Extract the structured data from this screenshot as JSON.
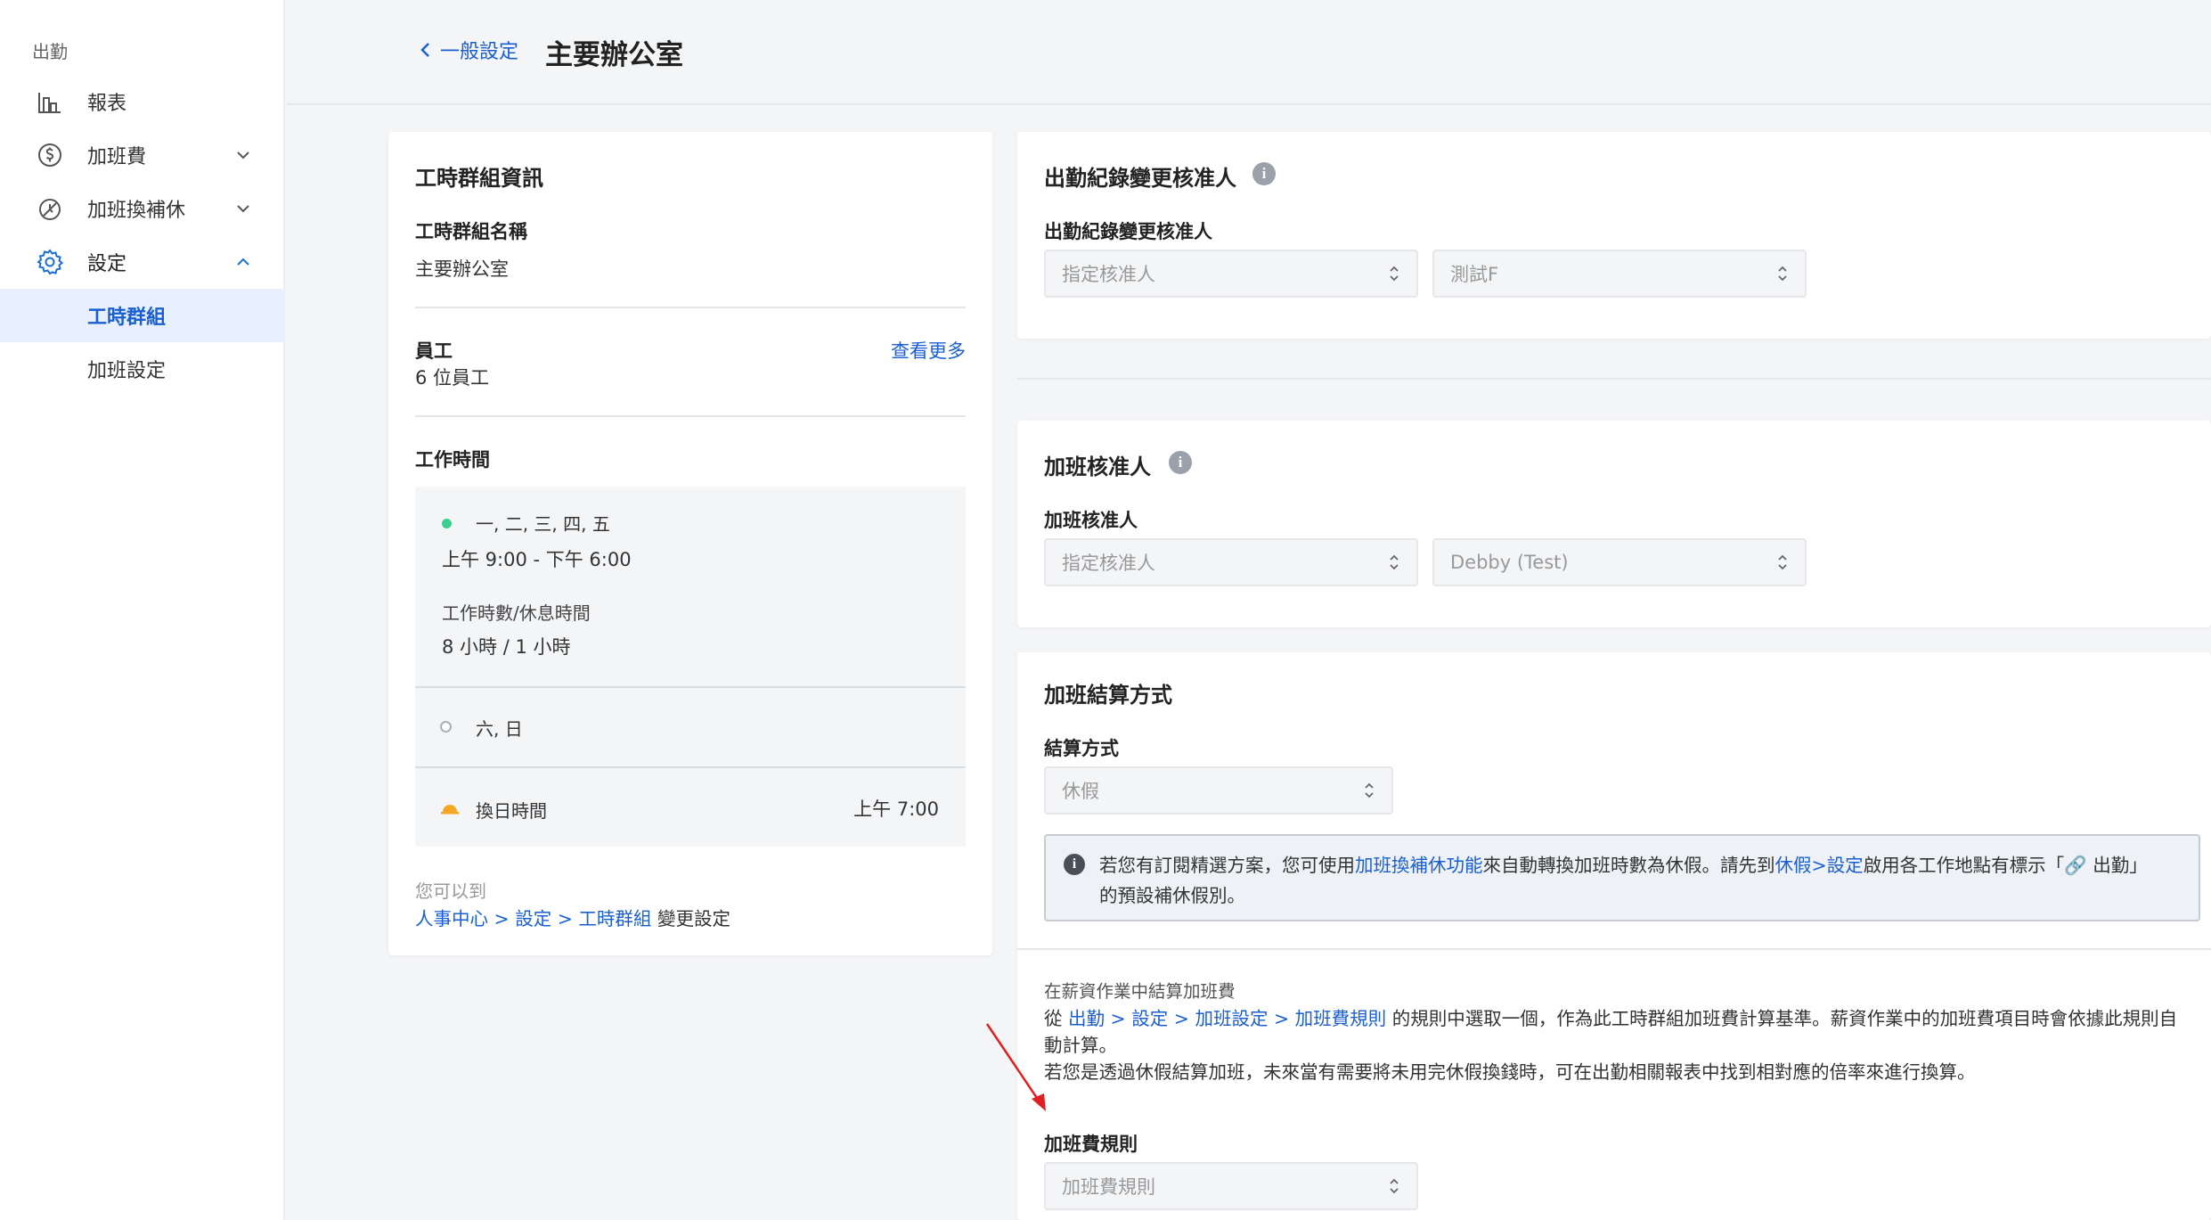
{
  "sidebar": {
    "section_title": "出勤",
    "items": [
      {
        "label": "報表",
        "icon": "report-chart-icon"
      },
      {
        "label": "加班費",
        "icon": "dollar-circle-icon"
      },
      {
        "label": "加班換補休",
        "icon": "swap-time-icon"
      },
      {
        "label": "設定",
        "icon": "gear-icon"
      },
      {
        "label": "工時群組"
      },
      {
        "label": "加班設定"
      }
    ]
  },
  "header": {
    "back_label": "一般設定",
    "title": "主要辦公室"
  },
  "left_card": {
    "title": "工時群組資訊",
    "group_name_label": "工時群組名稱",
    "group_name_value": "主要辦公室",
    "employees_label": "員工",
    "employees_value": "6 位員工",
    "view_more": "查看更多",
    "work_time_label": "工作時間",
    "workdays": "一, 二, 三, 四, 五",
    "workhours": "上午 9:00 - 下午 6:00",
    "hours_break_label": "工作時數/休息時間",
    "hours_break_value": "8 小時 / 1 小時",
    "weekend": "六, 日",
    "day_change_label": "換日時間",
    "day_change_value": "上午 7:00",
    "footer_prefix": "您可以到",
    "footer_path": "人事中心 > 設定 > 工時群組",
    "footer_suffix": " 變更設定"
  },
  "attendance_approver": {
    "title": "出勤紀錄變更核准人",
    "field_label": "出勤紀錄變更核准人",
    "select1": "指定核准人",
    "select2": "測試F"
  },
  "overtime_approver": {
    "title": "加班核准人",
    "field_label": "加班核准人",
    "select1": "指定核准人",
    "select2": "Debby (Test)"
  },
  "settlement": {
    "title": "加班結算方式",
    "method_label": "結算方式",
    "method_value": "休假",
    "note_part1": "若您有訂閱精選方案，您可使用",
    "note_link1": "加班換補休功能",
    "note_part2": "來自動轉換加班時數為休假。請先到",
    "note_link2": "休假>設定",
    "note_part3": "啟用各工作地點有標示「🔗 出勤」",
    "note_part4": "的預設補休假別。",
    "payroll_subtitle": "在薪資作業中結算加班費",
    "payroll_from": "從 ",
    "payroll_path": "出勤 > 設定 > 加班設定 > 加班費規則",
    "payroll_rest1": " 的規則中選取一個，作為此工時群組加班費計算基準。薪資作業中的加班費項目時會依據此規則自",
    "payroll_rest2": "動計算。",
    "payroll_line3": "若您是透過休假結算加班，未來當有需要將未用完休假換錢時，可在出勤相關報表中找到相對應的倍率來進行換算。",
    "rule_label": "加班費規則",
    "rule_placeholder": "加班費規則"
  },
  "colors": {
    "accent": "#1a5fd1",
    "sidebar_active_bg": "#e8f0fd",
    "green_dot": "#3ecf8e",
    "arrow_red": "#e02020"
  }
}
